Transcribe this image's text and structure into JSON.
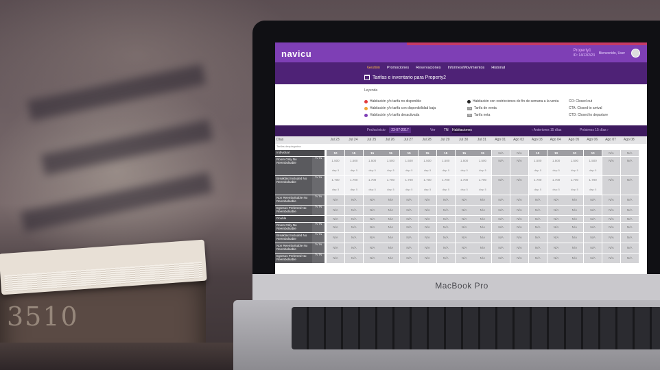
{
  "device": {
    "label": "MacBook Pro"
  },
  "box": {
    "label": "3510"
  },
  "app": {
    "logo": "navicu",
    "property_name": "Property1",
    "property_sub": "ID: 14/13/2/23",
    "user": "Bienvenido, User",
    "nav": [
      "Gestión",
      "Promociones",
      "Reservaciones",
      "Informes/Movimientos",
      "Historial"
    ],
    "page_title": "Tarifas e inventario para Property2"
  },
  "legend": {
    "title": "Leyenda",
    "items": [
      {
        "text": "Habitación y/o tarifa no disponible",
        "color": "#e23b3b"
      },
      {
        "text": "Habitación y/o tarifa con disponibilidad baja",
        "color": "#f0a531"
      },
      {
        "text": "Habitación y/o tarifa desactivada",
        "color": "#7e3fb5"
      },
      {
        "text": "Habitación con restricciones de fin de semana a la venta",
        "color": "#222222"
      },
      {
        "text": "Tarifa de venta",
        "badge": "TV"
      },
      {
        "text": "Tarifa neta",
        "badge": "TN"
      },
      {
        "text": "CO: Closed out"
      },
      {
        "text": "CTA: Closed to arrival"
      },
      {
        "text": "CTD: Closed to departure"
      }
    ]
  },
  "filters": {
    "date_label": "Fecha inicio",
    "date_value": "23-07-2017",
    "view_label": "Ver",
    "view_toggle": "TN",
    "view_select": "Habitaciones",
    "prev_days": "Anteriores 15 días",
    "next_days": "Próximos 15 días"
  },
  "grid": {
    "first_header": "Días",
    "header_sub": "Tarifas desplegadas",
    "days": [
      "Jul 23",
      "Jul 24",
      "Jul 25",
      "Jul 26",
      "Jul 27",
      "Jul 28",
      "Jul 29",
      "Jul 30",
      "Jul 31",
      "Ago 01",
      "Ago 02",
      "Ago 03",
      "Ago 04",
      "Ago 05",
      "Ago 06",
      "Ago 07",
      "Ago 08"
    ],
    "rows": [
      {
        "label": "Individual",
        "kind": "section",
        "cells": [
          "10",
          "15",
          "15",
          "15",
          "15",
          "15",
          "15",
          "15",
          "15",
          "N/A",
          "N/A",
          "10",
          "10",
          "10",
          "10",
          "N/A",
          "N/A"
        ]
      },
      {
        "label": "Room Only No Reembolsable",
        "kind": "rate",
        "cells": [
          "1.500",
          "1.500",
          "1.500",
          "1.500",
          "1.500",
          "1.500",
          "1.500",
          "1.500",
          "1.500",
          "N/A",
          "N/A",
          "1.500",
          "1.500",
          "1.500",
          "1.500",
          "N/A",
          "N/A"
        ],
        "sub": "disp: 5"
      },
      {
        "label": "Breakfast Included No Reembolsable",
        "kind": "rate",
        "cells": [
          "1.700",
          "1.700",
          "1.700",
          "1.700",
          "1.700",
          "1.700",
          "1.700",
          "1.700",
          "1.700",
          "N/A",
          "N/A",
          "1.700",
          "1.700",
          "1.700",
          "1.700",
          "N/A",
          "N/A"
        ],
        "sub": "disp: 5"
      },
      {
        "label": "Non Reembolsable No Reembolsable",
        "kind": "na",
        "cells": [
          "N/A",
          "N/A",
          "N/A",
          "N/A",
          "N/A",
          "N/A",
          "N/A",
          "N/A",
          "N/A",
          "N/A",
          "N/A",
          "N/A",
          "N/A",
          "N/A",
          "N/A",
          "N/A",
          "N/A"
        ]
      },
      {
        "label": "Egresos Preferred No Reembolsable",
        "kind": "na",
        "cells": [
          "N/A",
          "N/A",
          "N/A",
          "N/A",
          "N/A",
          "N/A",
          "N/A",
          "N/A",
          "N/A",
          "N/A",
          "N/A",
          "N/A",
          "N/A",
          "N/A",
          "N/A",
          "N/A",
          "N/A"
        ]
      },
      {
        "label": "Double",
        "kind": "section",
        "cells": [
          "N/A",
          "N/A",
          "N/A",
          "N/A",
          "N/A",
          "N/A",
          "N/A",
          "N/A",
          "N/A",
          "N/A",
          "N/A",
          "N/A",
          "N/A",
          "N/A",
          "N/A",
          "N/A",
          "N/A"
        ]
      },
      {
        "label": "Room Only No Reembolsable",
        "kind": "na",
        "cells": [
          "N/A",
          "N/A",
          "N/A",
          "N/A",
          "N/A",
          "N/A",
          "N/A",
          "N/A",
          "N/A",
          "N/A",
          "N/A",
          "N/A",
          "N/A",
          "N/A",
          "N/A",
          "N/A",
          "N/A"
        ]
      },
      {
        "label": "Breakfast Included No Reembolsable",
        "kind": "na",
        "cells": [
          "N/A",
          "N/A",
          "N/A",
          "N/A",
          "N/A",
          "N/A",
          "N/A",
          "N/A",
          "N/A",
          "N/A",
          "N/A",
          "N/A",
          "N/A",
          "N/A",
          "N/A",
          "N/A",
          "N/A"
        ]
      },
      {
        "label": "Non Reembolsable No Reembolsable",
        "kind": "na",
        "cells": [
          "N/A",
          "N/A",
          "N/A",
          "N/A",
          "N/A",
          "N/A",
          "N/A",
          "N/A",
          "N/A",
          "N/A",
          "N/A",
          "N/A",
          "N/A",
          "N/A",
          "N/A",
          "N/A",
          "N/A"
        ]
      },
      {
        "label": "Egresos Preferred No Reembolsable",
        "kind": "na",
        "cells": [
          "N/A",
          "N/A",
          "N/A",
          "N/A",
          "N/A",
          "N/A",
          "N/A",
          "N/A",
          "N/A",
          "N/A",
          "N/A",
          "N/A",
          "N/A",
          "N/A",
          "N/A",
          "N/A",
          "N/A"
        ]
      }
    ]
  },
  "colors": {
    "brand": "#7e3fb5",
    "nav": "#4e2276",
    "accent": "#c63a66",
    "active_nav": "#f6b54a"
  }
}
